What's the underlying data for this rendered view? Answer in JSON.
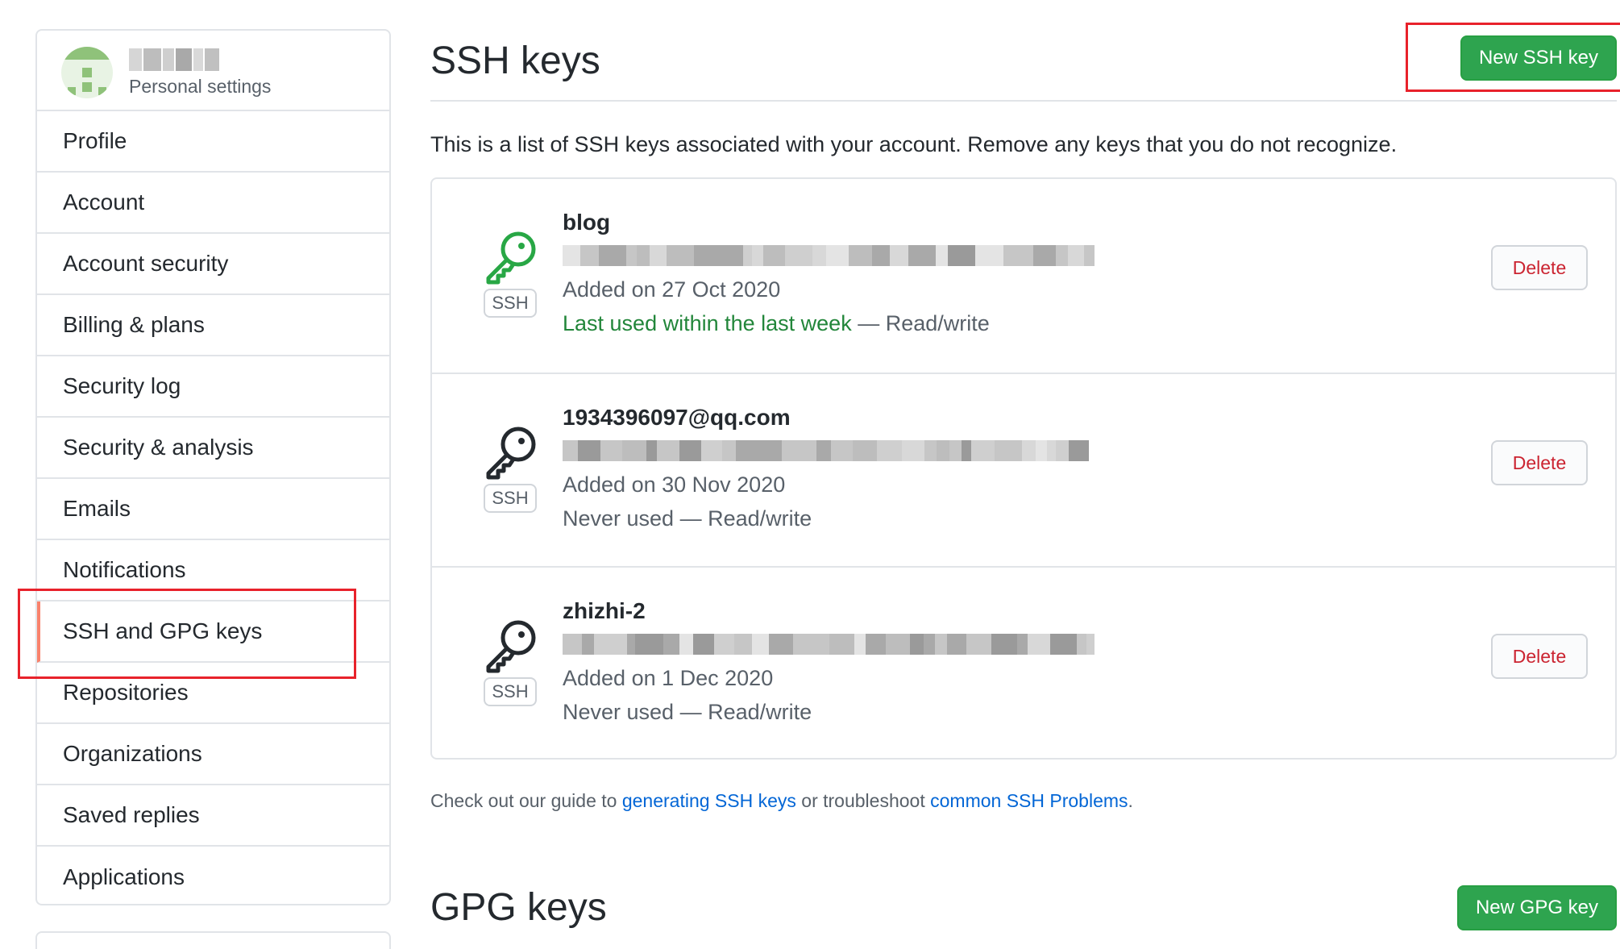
{
  "sidebar": {
    "subtitle": "Personal settings",
    "items": [
      {
        "label": "Profile"
      },
      {
        "label": "Account"
      },
      {
        "label": "Account security"
      },
      {
        "label": "Billing & plans"
      },
      {
        "label": "Security log"
      },
      {
        "label": "Security & analysis"
      },
      {
        "label": "Emails"
      },
      {
        "label": "Notifications"
      },
      {
        "label": "SSH and GPG keys",
        "selected": true
      },
      {
        "label": "Repositories"
      },
      {
        "label": "Organizations"
      },
      {
        "label": "Saved replies"
      },
      {
        "label": "Applications"
      }
    ]
  },
  "ssh": {
    "title": "SSH keys",
    "new_button": "New SSH key",
    "intro": "This is a list of SSH keys associated with your account. Remove any keys that you do not recognize.",
    "badge": "SSH",
    "delete_label": "Delete",
    "keys": [
      {
        "title": "blog",
        "added": "Added on 27 Oct 2020",
        "usage_recent": "Last used within the last week",
        "usage_rest": " — Read/write",
        "icon_color": "#28a745"
      },
      {
        "title": "1934396097@qq.com",
        "added": "Added on 30 Nov 2020",
        "usage_recent": "",
        "usage_rest": "Never used — Read/write",
        "icon_color": "#24292e"
      },
      {
        "title": "zhizhi-2",
        "added": "Added on 1 Dec 2020",
        "usage_recent": "",
        "usage_rest": "Never used — Read/write",
        "icon_color": "#24292e"
      }
    ],
    "guide": {
      "prefix": "Check out our guide to ",
      "link1": "generating SSH keys",
      "middle": " or troubleshoot ",
      "link2": "common SSH Problems",
      "suffix": "."
    }
  },
  "gpg": {
    "title": "GPG keys",
    "new_button": "New GPG key"
  },
  "colors": {
    "accent_green": "#2ea44f",
    "link_blue": "#0366d6",
    "danger_red": "#cb2431",
    "annotation_red": "#e8222b"
  }
}
